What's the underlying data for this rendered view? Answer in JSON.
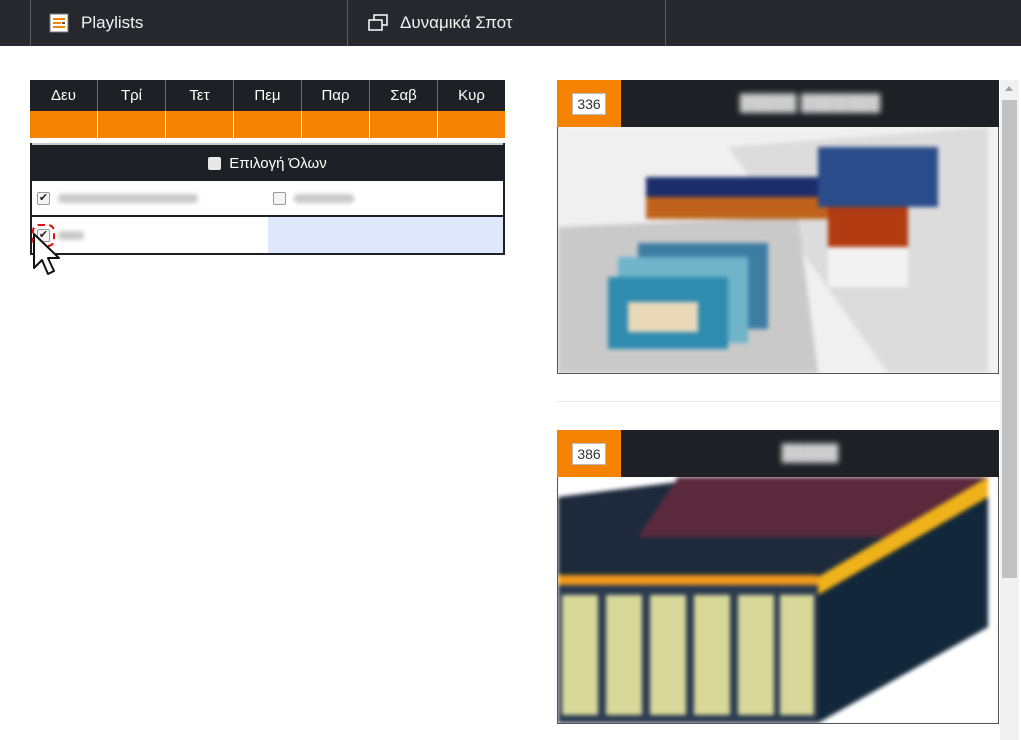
{
  "tabs": [
    {
      "label": "Playlists",
      "icon": "playlist-icon"
    },
    {
      "label": "Δυναμικά Σποτ",
      "icon": "windows-icon"
    }
  ],
  "schedule": {
    "days": [
      "Δευ",
      "Τρί",
      "Τετ",
      "Πεμ",
      "Παρ",
      "Σαβ",
      "Κυρ"
    ],
    "select_all_label": "Επιλογή Όλων",
    "rows": [
      [
        {
          "checked": true
        },
        {
          "checked": false
        }
      ],
      [
        {
          "checked": true
        },
        null
      ]
    ]
  },
  "previews": [
    {
      "number": "336"
    },
    {
      "number": "386"
    }
  ],
  "colors": {
    "accent": "#f58200",
    "dark": "#1e2025"
  }
}
